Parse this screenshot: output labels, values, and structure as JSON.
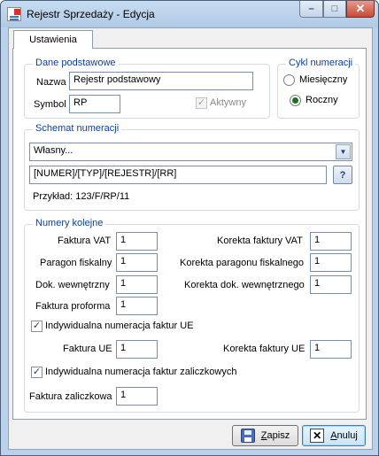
{
  "window": {
    "title": "Rejestr Sprzedaży - Edycja"
  },
  "tabs": [
    {
      "label": "Ustawienia"
    }
  ],
  "basic": {
    "group_title": "Dane podstawowe",
    "name_label": "Nazwa",
    "name_value": "Rejestr podstawowy",
    "symbol_label": "Symbol",
    "symbol_value": "RP",
    "active_label": "Aktywny",
    "active_checked": true
  },
  "cycle": {
    "group_title": "Cykl numeracji",
    "options": [
      {
        "label": "Miesięczny",
        "selected": false
      },
      {
        "label": "Roczny",
        "selected": true
      }
    ]
  },
  "scheme": {
    "group_title": "Schemat numeracji",
    "combo_value": "Własny...",
    "pattern_value": "[NUMER]/[TYP]/[REJESTR]/[RR]",
    "help_button": "?",
    "example_label": "Przykład: 123/F/RP/11"
  },
  "sequences": {
    "group_title": "Numery kolejne",
    "left": [
      {
        "label": "Faktura VAT",
        "value": "1"
      },
      {
        "label": "Paragon fiskalny",
        "value": "1"
      },
      {
        "label": "Dok. wewnętrzny",
        "value": "1"
      },
      {
        "label": "Faktura proforma",
        "value": "1"
      }
    ],
    "right": [
      {
        "label": "Korekta faktury VAT",
        "value": "1"
      },
      {
        "label": "Korekta paragonu fiskalnego",
        "value": "1"
      },
      {
        "label": "Korekta dok. wewnętrznego",
        "value": "1"
      }
    ],
    "ue_checkbox_label": "Indywidualna numeracja faktur UE",
    "ue_checked": true,
    "ue_invoice_label": "Faktura UE",
    "ue_invoice_value": "1",
    "ue_correction_label": "Korekta faktury UE",
    "ue_correction_value": "1",
    "advance_checkbox_label": "Indywidualna numeracja faktur zaliczkowych",
    "advance_checked": true,
    "advance_invoice_label": "Faktura zaliczkowa",
    "advance_invoice_value": "1"
  },
  "buttons": {
    "save": "Zapisz",
    "cancel": "Anuluj"
  },
  "glyphs": {
    "check": "✓",
    "arrow_down": "▼",
    "close": "✕",
    "minimize": "–",
    "maximize": "□"
  },
  "colors": {
    "group_title": "#0a3ea8",
    "titlebar": "#b9d1ea",
    "close_button": "#c74a37"
  }
}
